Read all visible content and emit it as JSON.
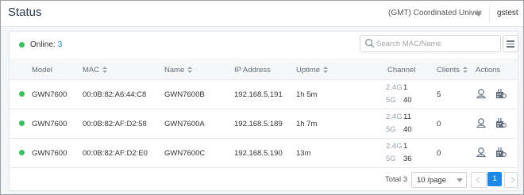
{
  "header": {
    "title": "Status",
    "timezone": "(GMT) Coordinated Univer",
    "user": "gstest"
  },
  "toolbar": {
    "online_label": "Online:",
    "online_count": "3",
    "search_placeholder": "Search MAC/Name"
  },
  "table": {
    "columns": {
      "model": "Model",
      "mac": "MAC",
      "name": "Name",
      "ip": "IP Address",
      "uptime": "Uptime",
      "channel": "Channel",
      "clients": "Clients",
      "actions": "Actions"
    },
    "rows": [
      {
        "model": "GWN7600",
        "mac": "00:0B:82:A6:44:C8",
        "name": "GWN7600B",
        "ip": "192.168.5.191",
        "uptime": "1h 5m",
        "band24": "2.4G",
        "ch24": "1",
        "band5": "5G",
        "ch5": "40",
        "clients": "5"
      },
      {
        "model": "GWN7600",
        "mac": "00:0B:82:AF:D2:58",
        "name": "GWN7600A",
        "ip": "192.168.5.189",
        "uptime": "1h 7m",
        "band24": "2.4G",
        "ch24": "11",
        "band5": "5G",
        "ch5": "40",
        "clients": "0"
      },
      {
        "model": "GWN7600",
        "mac": "00:0B:82:AF:D2:E0",
        "name": "GWN7600C",
        "ip": "192.168.5.190",
        "uptime": "13m",
        "band24": "2.4G",
        "ch24": "1",
        "band5": "5G",
        "ch5": "36",
        "clients": "0"
      }
    ]
  },
  "pagination": {
    "total_label": "Total 3",
    "page_size": "10 /page",
    "current_page": "1"
  },
  "colors": {
    "online": "#35c45b",
    "accent": "#1e88e5"
  },
  "icons": {
    "search": "search-icon",
    "menu": "menu-icon",
    "locate": "locate-icon",
    "config": "config-icon"
  }
}
